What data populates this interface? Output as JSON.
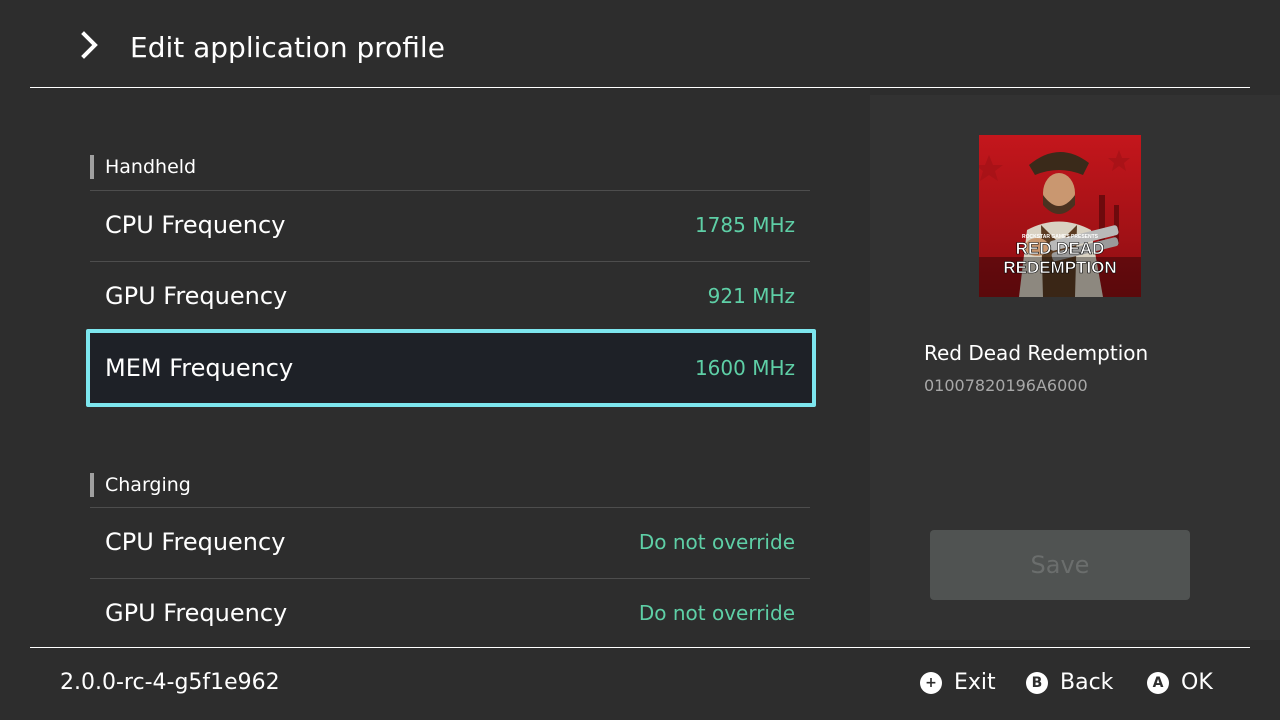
{
  "header": {
    "title": "Edit application profile",
    "back_icon": "chevron-right-icon"
  },
  "sections": [
    {
      "label": "Handheld",
      "items": [
        {
          "label": "CPU Frequency",
          "value": "1785 MHz"
        },
        {
          "label": "GPU Frequency",
          "value": "921 MHz"
        },
        {
          "label": "MEM Frequency",
          "value": "1600 MHz",
          "selected": true
        }
      ]
    },
    {
      "label": "Charging",
      "items": [
        {
          "label": "CPU Frequency",
          "value": "Do not override"
        },
        {
          "label": "GPU Frequency",
          "value": "Do not override"
        }
      ]
    }
  ],
  "app": {
    "title": "Red Dead Redemption",
    "id": "01007820196A6000",
    "cover_text": {
      "publisher": "ROCKSTAR GAMES PRESENTS",
      "line1": "RED DEAD",
      "line2": "REDEMPTION"
    }
  },
  "save_button": {
    "label": "Save",
    "enabled": false
  },
  "footer": {
    "version": "2.0.0-rc-4-g5f1e962",
    "hints": [
      {
        "glyph": "+",
        "icon": "plus-button-icon",
        "label": "Exit"
      },
      {
        "glyph": "B",
        "icon": "b-button-icon",
        "label": "Back"
      },
      {
        "glyph": "A",
        "icon": "a-button-icon",
        "label": "OK"
      }
    ]
  },
  "colors": {
    "background": "#2d2d2d",
    "panel": "#323232",
    "value_accent": "#5ecfa6",
    "selection_border": "#7de6ee",
    "selection_fill": "#1e2127",
    "save_disabled": "#505352"
  }
}
